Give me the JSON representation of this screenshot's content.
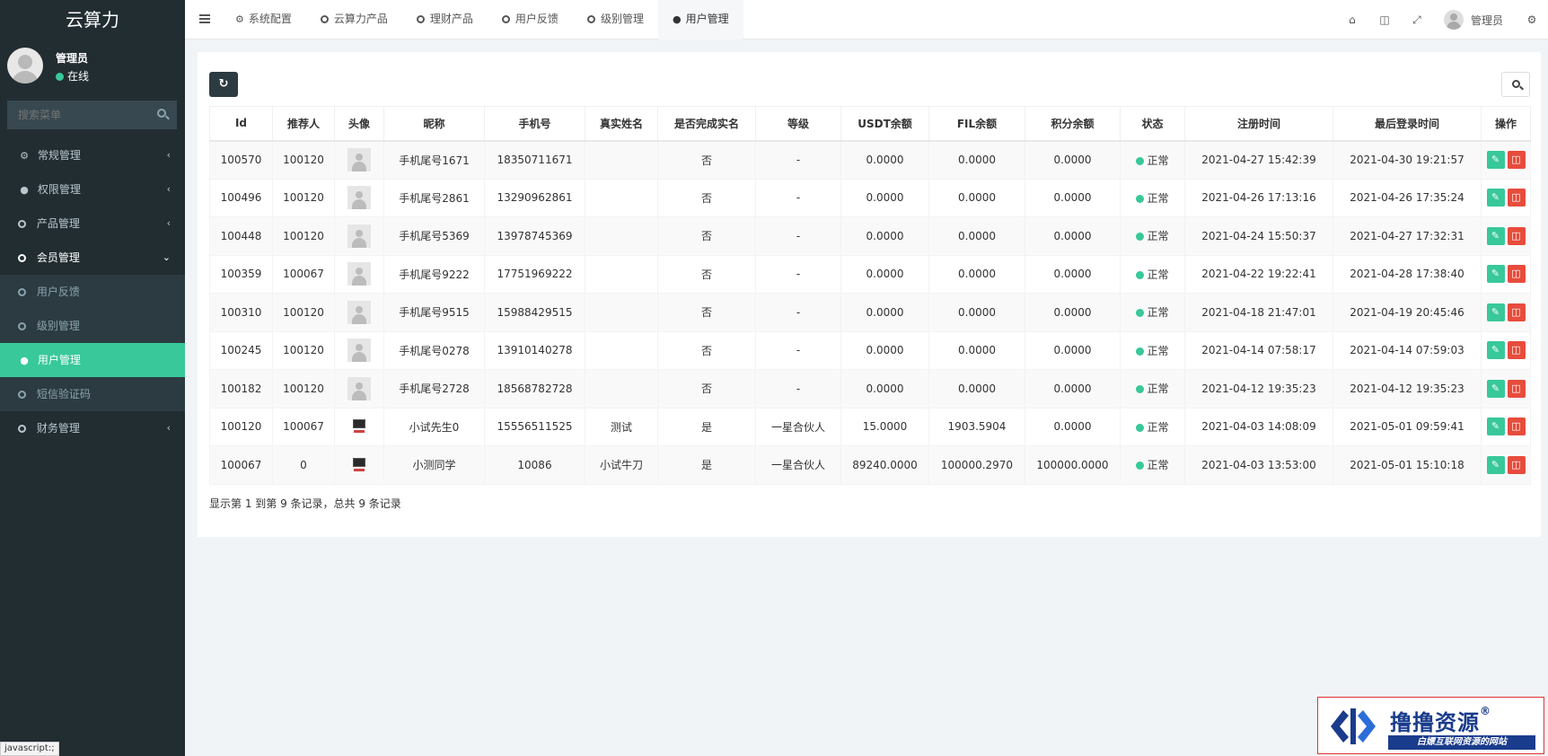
{
  "sidebar": {
    "brand": "云算力",
    "user_name": "管理员",
    "user_status": "在线",
    "search_placeholder": "搜索菜单",
    "items": [
      {
        "label": "常规管理",
        "icon": "cogs-icon"
      },
      {
        "label": "权限管理",
        "icon": "users-icon"
      },
      {
        "label": "产品管理",
        "icon": "circle-icon"
      },
      {
        "label": "会员管理",
        "icon": "circle-icon"
      }
    ],
    "sub_items": [
      {
        "label": "用户反馈"
      },
      {
        "label": "级别管理"
      },
      {
        "label": "用户管理"
      },
      {
        "label": "短信验证码"
      }
    ],
    "finance_label": "财务管理"
  },
  "status_tip": "javascript:;",
  "topbar": {
    "tabs": [
      {
        "label": "系统配置"
      },
      {
        "label": "云算力产品"
      },
      {
        "label": "理财产品"
      },
      {
        "label": "用户反馈"
      },
      {
        "label": "级别管理"
      },
      {
        "label": "用户管理"
      }
    ],
    "user": "管理员"
  },
  "table": {
    "headers": [
      "Id",
      "推荐人",
      "头像",
      "昵称",
      "手机号",
      "真实姓名",
      "是否完成实名",
      "等级",
      "USDT余额",
      "FIL余额",
      "积分余额",
      "状态",
      "注册时间",
      "最后登录时间",
      "操作"
    ],
    "rows": [
      {
        "id": "100570",
        "ref": "100120",
        "avatar": "default",
        "nick": "手机尾号1671",
        "phone": "18350711671",
        "real": "",
        "verified": "否",
        "level": "-",
        "usdt": "0.0000",
        "fil": "0.0000",
        "points": "0.0000",
        "status": "正常",
        "reg": "2021-04-27 15:42:39",
        "last": "2021-04-30 19:21:57"
      },
      {
        "id": "100496",
        "ref": "100120",
        "avatar": "default",
        "nick": "手机尾号2861",
        "phone": "13290962861",
        "real": "",
        "verified": "否",
        "level": "-",
        "usdt": "0.0000",
        "fil": "0.0000",
        "points": "0.0000",
        "status": "正常",
        "reg": "2021-04-26 17:13:16",
        "last": "2021-04-26 17:35:24"
      },
      {
        "id": "100448",
        "ref": "100120",
        "avatar": "default",
        "nick": "手机尾号5369",
        "phone": "13978745369",
        "real": "",
        "verified": "否",
        "level": "-",
        "usdt": "0.0000",
        "fil": "0.0000",
        "points": "0.0000",
        "status": "正常",
        "reg": "2021-04-24 15:50:37",
        "last": "2021-04-27 17:32:31"
      },
      {
        "id": "100359",
        "ref": "100067",
        "avatar": "default",
        "nick": "手机尾号9222",
        "phone": "17751969222",
        "real": "",
        "verified": "否",
        "level": "-",
        "usdt": "0.0000",
        "fil": "0.0000",
        "points": "0.0000",
        "status": "正常",
        "reg": "2021-04-22 19:22:41",
        "last": "2021-04-28 17:38:40"
      },
      {
        "id": "100310",
        "ref": "100120",
        "avatar": "default",
        "nick": "手机尾号9515",
        "phone": "15988429515",
        "real": "",
        "verified": "否",
        "level": "-",
        "usdt": "0.0000",
        "fil": "0.0000",
        "points": "0.0000",
        "status": "正常",
        "reg": "2021-04-18 21:47:01",
        "last": "2021-04-19 20:45:46"
      },
      {
        "id": "100245",
        "ref": "100120",
        "avatar": "default",
        "nick": "手机尾号0278",
        "phone": "13910140278",
        "real": "",
        "verified": "否",
        "level": "-",
        "usdt": "0.0000",
        "fil": "0.0000",
        "points": "0.0000",
        "status": "正常",
        "reg": "2021-04-14 07:58:17",
        "last": "2021-04-14 07:59:03"
      },
      {
        "id": "100182",
        "ref": "100120",
        "avatar": "default",
        "nick": "手机尾号2728",
        "phone": "18568782728",
        "real": "",
        "verified": "否",
        "level": "-",
        "usdt": "0.0000",
        "fil": "0.0000",
        "points": "0.0000",
        "status": "正常",
        "reg": "2021-04-12 19:35:23",
        "last": "2021-04-12 19:35:23"
      },
      {
        "id": "100120",
        "ref": "100067",
        "avatar": "computer",
        "nick": "小试先生0",
        "phone": "15556511525",
        "real": "测试",
        "verified": "是",
        "level": "一星合伙人",
        "usdt": "15.0000",
        "fil": "1903.5904",
        "points": "0.0000",
        "status": "正常",
        "reg": "2021-04-03 14:08:09",
        "last": "2021-05-01 09:59:41"
      },
      {
        "id": "100067",
        "ref": "0",
        "avatar": "computer",
        "nick": "小测同学",
        "phone": "10086",
        "real": "小试牛刀",
        "verified": "是",
        "level": "一星合伙人",
        "usdt": "89240.0000",
        "fil": "100000.2970",
        "points": "100000.0000",
        "status": "正常",
        "reg": "2021-04-03 13:53:00",
        "last": "2021-05-01 15:10:18"
      }
    ],
    "summary": "显示第 1 到第 9 条记录，总共 9 条记录"
  },
  "watermark": {
    "title": "撸撸资源",
    "reg": "®",
    "subtitle": "白嫖互联网资源的网站"
  },
  "colors": {
    "sidebar_bg": "#222d32",
    "accent": "#38c89a",
    "danger": "#e74c3c"
  }
}
